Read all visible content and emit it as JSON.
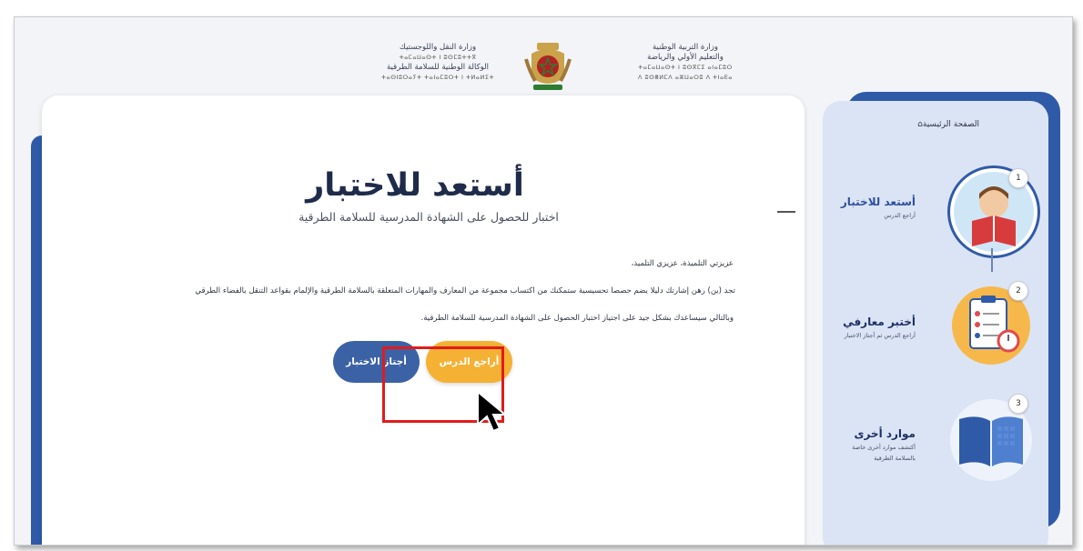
{
  "header": {
    "ministry_right": [
      "وزارة التربية الوطنية",
      "والتعليم الأولي والرياضة"
    ],
    "ministry_right_tifinagh": [
      "ⵜⴰⵎⴰⵡⴰⵙⵜ ⵏ ⵓⵙⴳⵎⵉ ⴰⵏⴰⵎⵓⵔ",
      "ⴷ ⵓⵙⴻⵍⵎⴷ ⴰⵣⵡⴰⵔⵓ ⴷ ⵜⵏⴰⴹⴰ"
    ],
    "ministry_left": [
      "وزارة النقل واللوجستيك",
      "الوكالة الوطنية للسلامة الطرقية"
    ],
    "ministry_left_tifinagh": [
      "ⵜⴰⵎⴰⵡⴰⵙⵜ ⵏ ⵓⵙⵎⵓⵜⵜⴳ",
      "ⵜⴰⵙⵏⵓⵔⴰⵢⵜ ⵜⴰⵏⴰⵎⵓⵔⵜ ⵏ ⵜⵍⴰⵍⵉⵜ"
    ]
  },
  "main": {
    "title": "أستعد للاختبار",
    "subtitle": "اختبار للحصول على الشهادة المدرسية للسلامة الطرقية",
    "greeting": "عزيزتي التلميذة، عزيزي التلميذ،",
    "paragraph_1": "تجد (ين) رهن إشارتك دليلا يضم حصصا تحسيسية ستمكنك من اكتساب مجموعة من المعارف والمهارات المتعلقة بالسلامة الطرقية والإلمام بقواعد التنقل بالفضاء الطرقي",
    "paragraph_2": "وبالتالي سيساعدك بشكل جيد على اجتياز اختبار الحصول على الشهادة المدرسية للسلامة الطرقية.",
    "btn_review": "أراجع الدرس",
    "btn_test": "أجتاز الاختبار"
  },
  "sidebar": {
    "home": "الصفحة الرئيسية",
    "steps": [
      {
        "num": "1",
        "title": "أستعد للاختبار",
        "sub": "أراجع الدرس"
      },
      {
        "num": "2",
        "title": "أختبر معارفي",
        "sub": "أراجع الدرس ثم أجتاز الاختبار"
      },
      {
        "num": "3",
        "title": "موارد أخرى",
        "sub": "أكتشف موارد أخرى خاصة",
        "sub2": "بالسلامة الطرقية"
      }
    ]
  },
  "colors": {
    "accent_blue": "#2f5aa8",
    "button_orange": "#f5b133",
    "button_blue": "#3c62a6",
    "highlight_red": "#e11b1b"
  }
}
